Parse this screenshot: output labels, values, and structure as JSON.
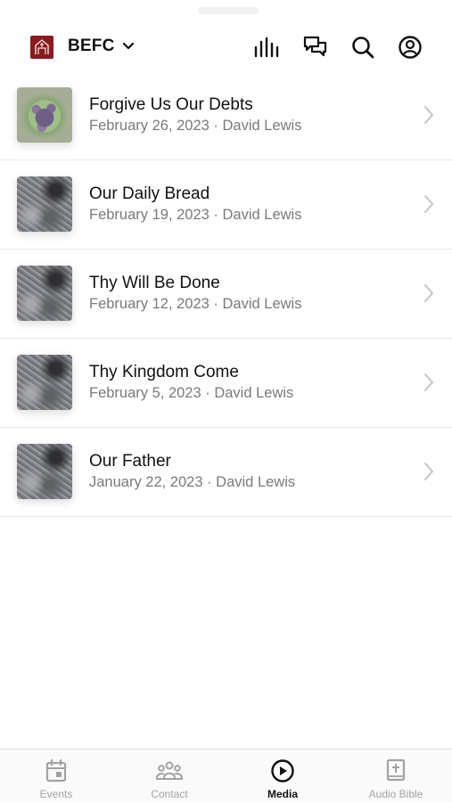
{
  "header": {
    "org_name": "BEFC",
    "icons": [
      "befc-logo",
      "chevron-down-icon",
      "bar-chart-icon",
      "chat-bubbles-icon",
      "search-icon",
      "profile-icon"
    ]
  },
  "sermons": [
    {
      "title": "Forgive Us Our Debts",
      "subtitle": "February 26, 2023 · David Lewis",
      "thumbnail": "flowers"
    },
    {
      "title": "Our Daily Bread",
      "subtitle": "February 19, 2023 · David Lewis",
      "thumbnail": "stone"
    },
    {
      "title": "Thy Will Be Done",
      "subtitle": "February 12, 2023 · David Lewis",
      "thumbnail": "stone"
    },
    {
      "title": "Thy Kingdom Come",
      "subtitle": "February 5, 2023 · David Lewis",
      "thumbnail": "stone"
    },
    {
      "title": "Our Father",
      "subtitle": "January 22, 2023 · David Lewis",
      "thumbnail": "stone"
    }
  ],
  "tabs": [
    {
      "label": "Events",
      "icon": "calendar-icon",
      "active": false
    },
    {
      "label": "Contact",
      "icon": "people-icon",
      "active": false
    },
    {
      "label": "Media",
      "icon": "play-circle-icon",
      "active": true
    },
    {
      "label": "Audio Bible",
      "icon": "bible-icon",
      "active": false
    }
  ],
  "colors": {
    "brand": "#8b1a1f",
    "active_tab": "#111111",
    "inactive_tab": "#a2a2a2"
  }
}
